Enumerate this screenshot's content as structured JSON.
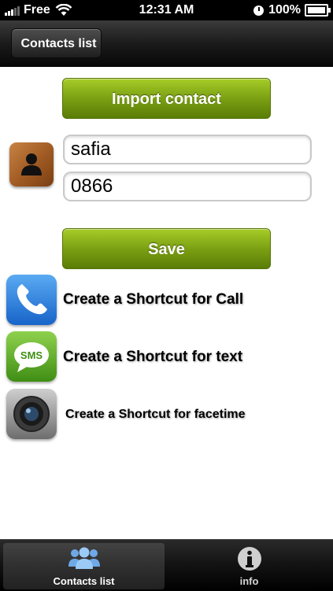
{
  "status_bar": {
    "carrier": "Free",
    "time": "12:31 AM",
    "battery": "100%"
  },
  "nav": {
    "back_label": "Contacts list"
  },
  "buttons": {
    "import_label": "Import contact",
    "save_label": "Save"
  },
  "contact": {
    "name_value": "safia",
    "phone_value": "0866"
  },
  "shortcuts": {
    "call_label": "Create a Shortcut for Call",
    "text_label": "Create a Shortcut for text",
    "sms_icon_text": "SMS",
    "facetime_label": "Create a Shortcut for facetime"
  },
  "tabs": [
    {
      "label": "Contacts list",
      "icon": "contacts-icon",
      "selected": true
    },
    {
      "label": "info",
      "icon": "info-icon",
      "selected": false
    }
  ],
  "colors": {
    "accent_green": "#7ba013",
    "bar_dark": "#1b1b1b"
  }
}
